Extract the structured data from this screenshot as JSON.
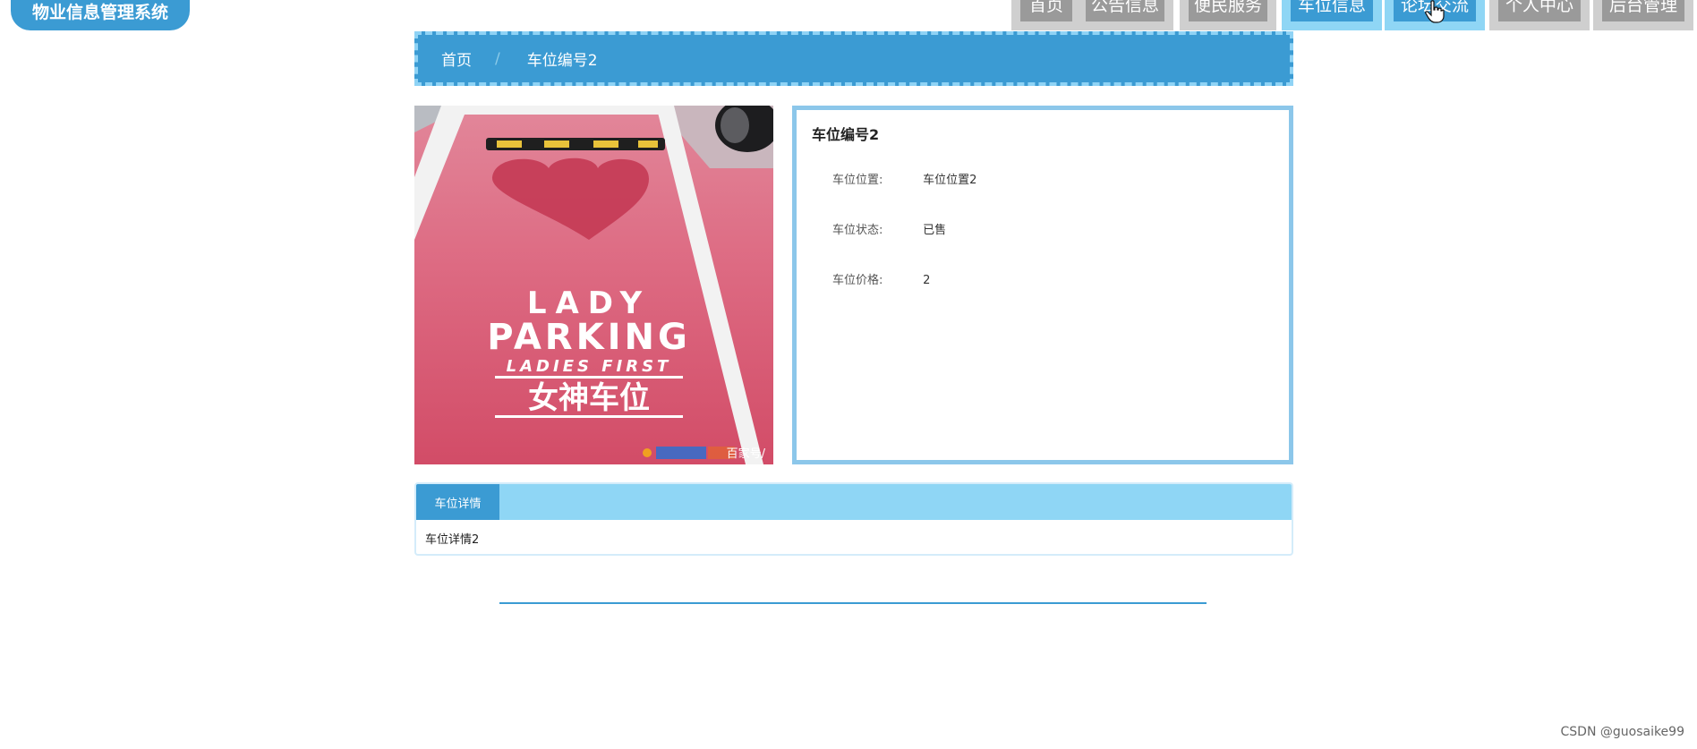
{
  "brand": {
    "title": "物业信息管理系统"
  },
  "nav": {
    "items": [
      {
        "label": "首页",
        "state": "normal"
      },
      {
        "label": "公告信息",
        "state": "normal"
      },
      {
        "label": "便民服务",
        "state": "normal"
      },
      {
        "label": "车位信息",
        "state": "active"
      },
      {
        "label": "论坛交流",
        "state": "hover"
      },
      {
        "label": "个人中心",
        "state": "normal"
      },
      {
        "label": "后台管理",
        "state": "normal"
      }
    ]
  },
  "breadcrumb": {
    "home": "首页",
    "separator": "/",
    "current": "车位编号2"
  },
  "photo": {
    "line1": "LADY",
    "line2": "PARKING",
    "line3": "LADIES FIRST",
    "line4": "女神车位",
    "corner_text": "百家号/"
  },
  "detail": {
    "title": "车位编号2",
    "fields": [
      {
        "label": "车位位置:",
        "value": "车位位置2"
      },
      {
        "label": "车位状态:",
        "value": "已售"
      },
      {
        "label": "车位价格:",
        "value": "2"
      }
    ]
  },
  "tabs": {
    "active_label": "车位详情",
    "content": "车位详情2"
  },
  "watermark": "CSDN @guosaike99",
  "colors": {
    "primary": "#3b9bd3",
    "light": "#8fd6f5",
    "tab_gray": "#9a9a9a"
  }
}
